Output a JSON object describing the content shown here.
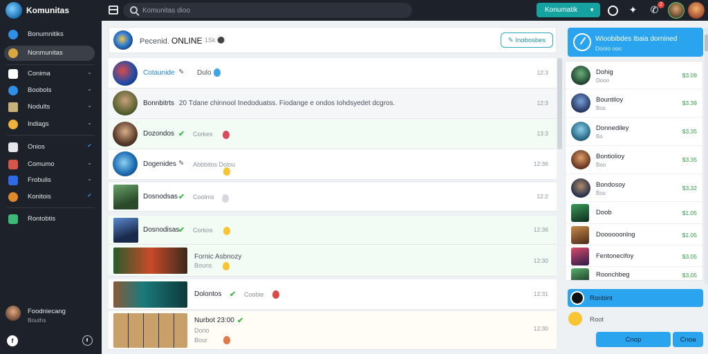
{
  "app": {
    "title": "Komunitas"
  },
  "search": {
    "placeholder": "Komunitas dioo"
  },
  "topbar": {
    "select_label": "Konumatik",
    "notification_count": "2"
  },
  "sidebar": {
    "items": [
      {
        "label": "Bonumnitiks",
        "chevron": ""
      },
      {
        "label": "Nonmunitas",
        "chevron": ""
      },
      {
        "label": "Conima",
        "chevron": "⌄"
      },
      {
        "label": "Boobols",
        "chevron": "⌄"
      },
      {
        "label": "Nodults",
        "chevron": "⌄"
      },
      {
        "label": "Indiags",
        "chevron": "⌄"
      },
      {
        "label": "Onios",
        "chevron": "✔"
      },
      {
        "label": "Comumo",
        "chevron": "⌄"
      },
      {
        "label": "Frobulis",
        "chevron": "⌄"
      },
      {
        "label": "Konitois",
        "chevron": "✔"
      },
      {
        "label": "Rontobtis",
        "chevron": ""
      }
    ],
    "profile": {
      "name": "Foodniecang",
      "sub": "Bouths"
    },
    "bottom_left": "f"
  },
  "feed": {
    "header": {
      "title": "Pecenid.",
      "status": "ONLINE",
      "meta": "1Sk  ⚫",
      "button": "✎ Inobosbes"
    },
    "rows": [
      {
        "name": "Cotaunide",
        "text": "Dulo",
        "sub": "",
        "time": "12:3"
      },
      {
        "name": "Bonnbitrts",
        "text": "20  Tdane chinnool Inedoduatss.  Fiodange e ondos  Iohdsyedet dcgros.",
        "sub": "",
        "time": "12:3"
      },
      {
        "name": "Dozondos",
        "text": "Corkes",
        "sub": "",
        "time": "13:3"
      },
      {
        "name": "Dogenides",
        "text": "Abbbitos  Dolou",
        "sub": "",
        "time": "12:36"
      },
      {
        "name": "Dosnodsas",
        "text": "Coolms",
        "sub": "",
        "time": "12:2"
      },
      {
        "name": "Dosnodisas",
        "text": "Corkos",
        "sub": "",
        "time": "12:36"
      },
      {
        "name": "",
        "text": "Fornic Asbnozy",
        "sub": "Bouns",
        "time": "12:30"
      },
      {
        "name": "Dolontos",
        "text": "Coobie",
        "sub": "",
        "time": "12:31"
      },
      {
        "name": "",
        "text": "Nurbot 23:00",
        "sub": "Bour",
        "time": "12:30"
      }
    ],
    "row_extras": {
      "row_9_line_2": "Dorio"
    }
  },
  "right_panel": {
    "title": "Wioobibdes Ibaia dornined",
    "subtitle": "Dooio ooc",
    "items": [
      {
        "name": "Dohig",
        "sub": "Dooo",
        "value": "$3.09"
      },
      {
        "name": "Bountiloy",
        "sub": "Bos",
        "value": "$3.39"
      },
      {
        "name": "Donnediley",
        "sub": "Bo",
        "value": "$3.35"
      },
      {
        "name": "Bontiolioy",
        "sub": "Boo",
        "value": "$3.35"
      },
      {
        "name": "Bondosoy",
        "sub": "Bos",
        "value": "$3.32"
      },
      {
        "name": "Doob",
        "sub": "",
        "value": "$1.05"
      },
      {
        "name": "Doooooonlng",
        "sub": "",
        "value": "$1.05"
      },
      {
        "name": "Fentonecifoy",
        "sub": "",
        "value": "$3.05"
      },
      {
        "name": "Roonchbeg",
        "sub": "",
        "value": "$3.05"
      }
    ],
    "composer_label": "Ronbint",
    "react_label": "Root",
    "buttons": [
      "Cnop",
      "Cnoa"
    ]
  },
  "colors": {
    "accent": "#2aa4ef",
    "teal": "#14a3a1",
    "sidebar_bg": "#1d2129",
    "online_green": "#3cba4a"
  }
}
